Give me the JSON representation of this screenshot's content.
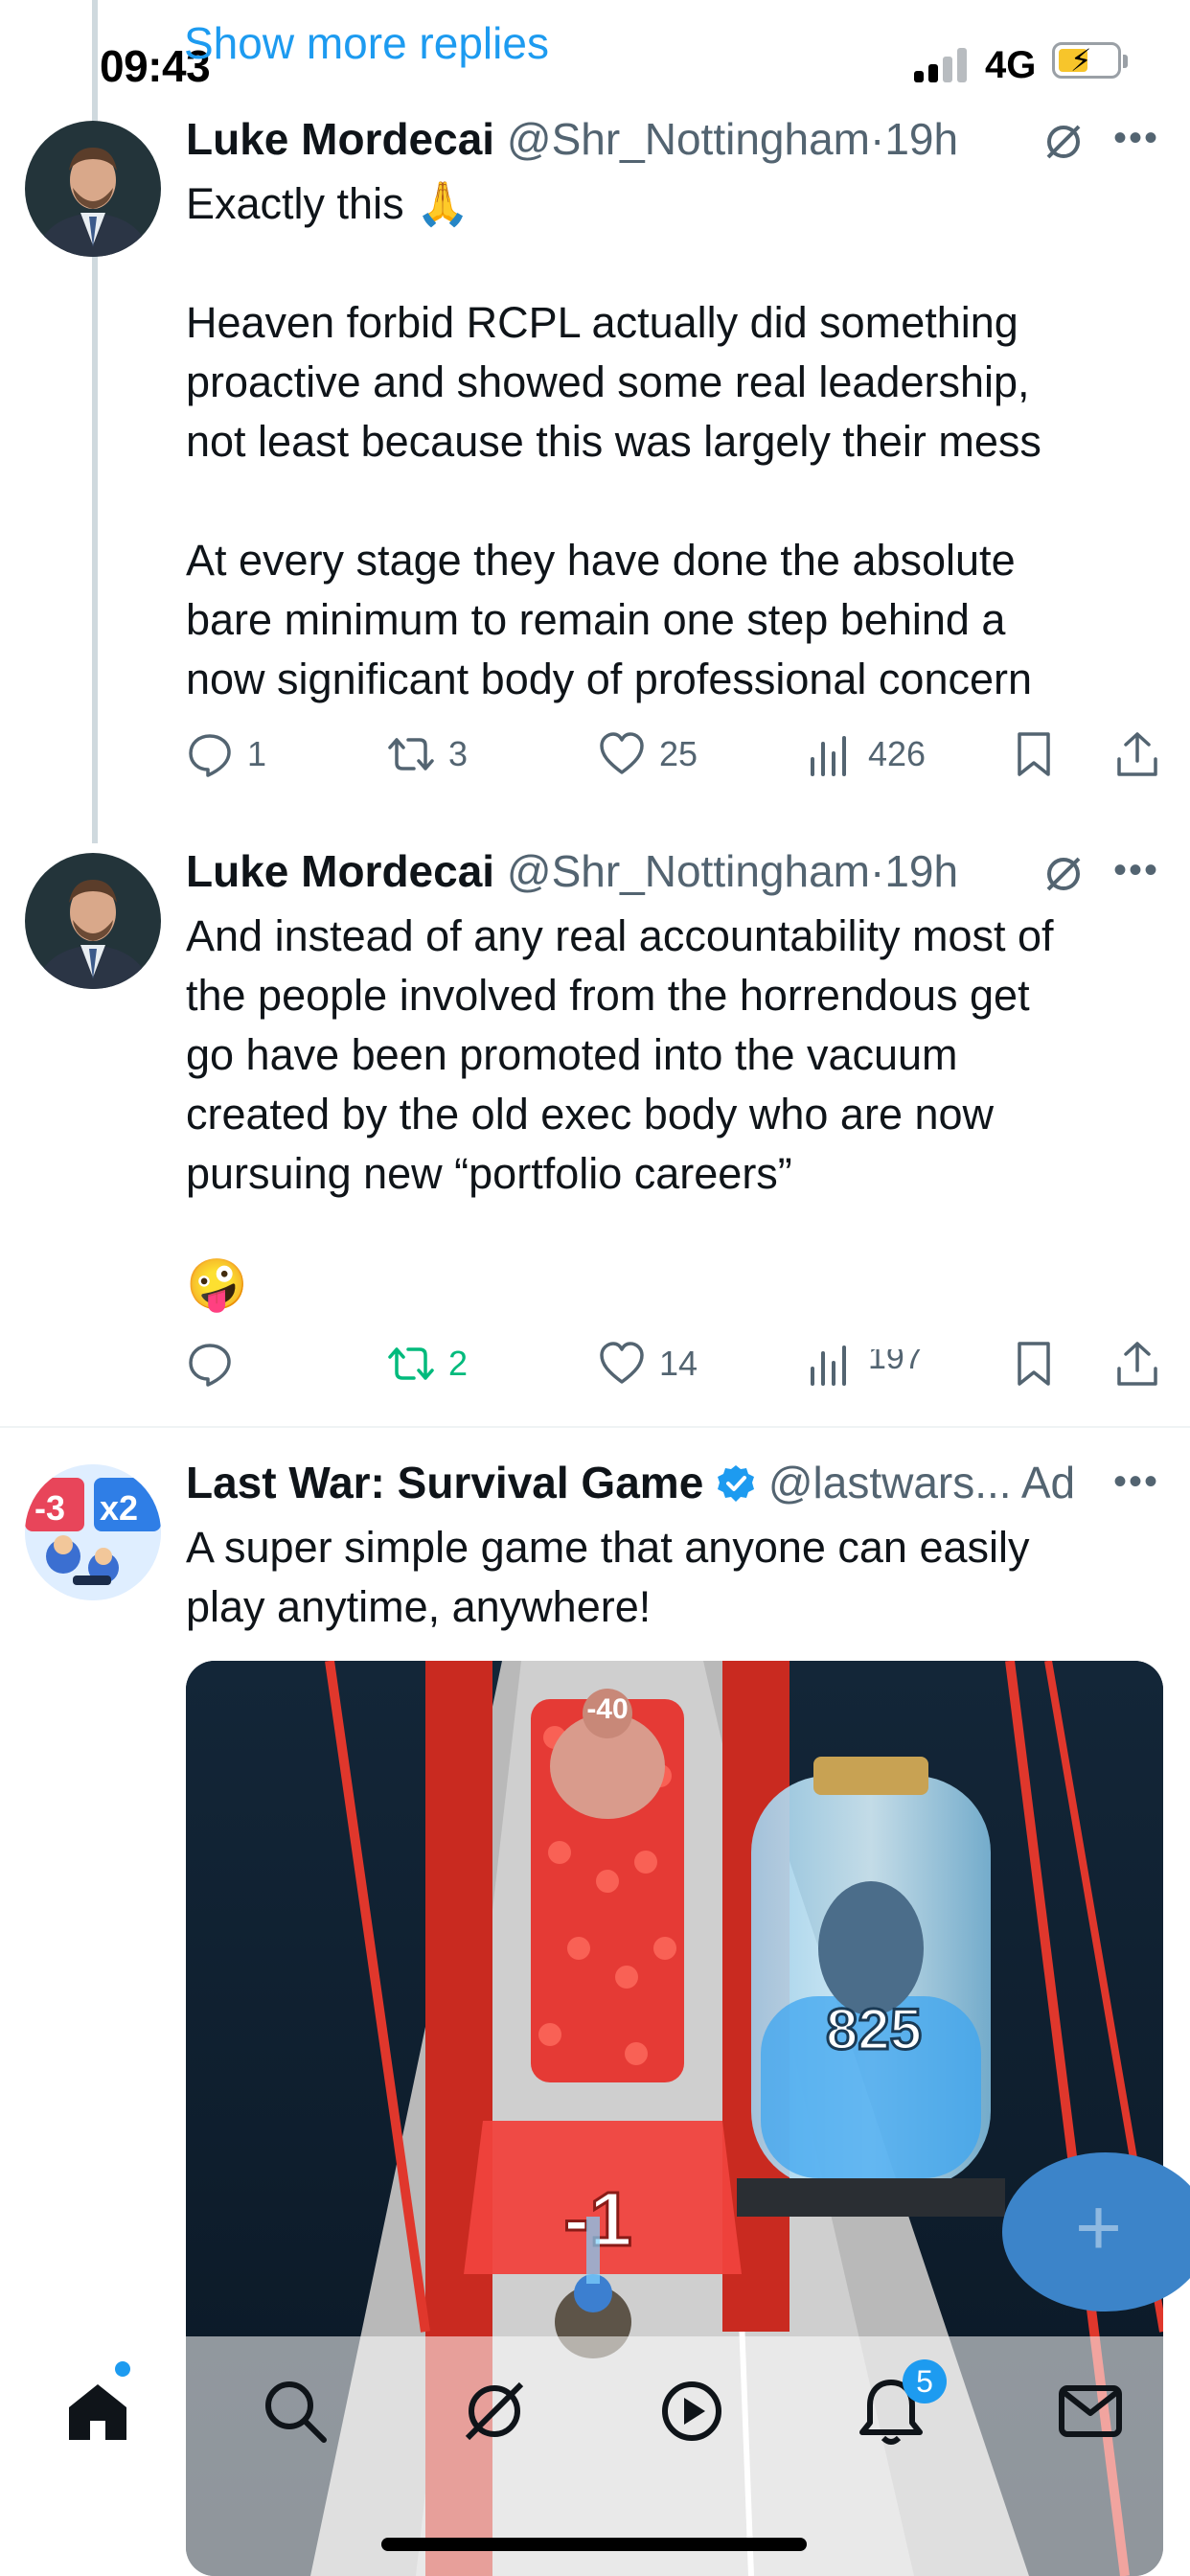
{
  "status_bar": {
    "time": "09:43",
    "network": "4G"
  },
  "thread": {
    "show_more_label": "Show more replies"
  },
  "tweets": [
    {
      "name": "Luke Mordecai",
      "handle": "@Shr_Nottingham",
      "sep": "·",
      "time": "19h",
      "emoji": "🙏",
      "body": "Exactly this",
      "body2": "Heaven forbid RCPL actually did something\nproactive and showed some real leadership,\nnot least because this was largely their mess\n\nAt every stage they have done the absolute\nbare minimum to remain one step behind a\nnow significant body of professional concern",
      "replies": "1",
      "reposts": "3",
      "likes": "25",
      "views": "426"
    },
    {
      "name": "Luke Mordecai",
      "handle": "@Shr_Nottingham",
      "sep": "·",
      "time": "19h",
      "body": "And instead of any real accountability most of\nthe people involved from the horrendous get\ngo have been promoted into the vacuum\ncreated by the old exec body who are now\npursuing new “portfolio careers”",
      "emoji": "🤪",
      "replies": "",
      "reposts": "2",
      "likes": "14",
      "views": "197"
    }
  ],
  "ad": {
    "name": "Last War: Survival Game",
    "handle": "@lastwars...",
    "label": "Ad",
    "body": "A super simple game that anyone can easily\nplay anytime, anywhere!",
    "media": {
      "gate_value": "-1",
      "jar_value": "825",
      "enemy_value": "-40"
    },
    "avatar_text": {
      "left": "-3",
      "right": "x2"
    }
  },
  "nav": {
    "notifications_badge": "5"
  },
  "colors": {
    "accent": "#1d9bf0",
    "repost_active": "#00ba7c",
    "muted": "#536471"
  }
}
